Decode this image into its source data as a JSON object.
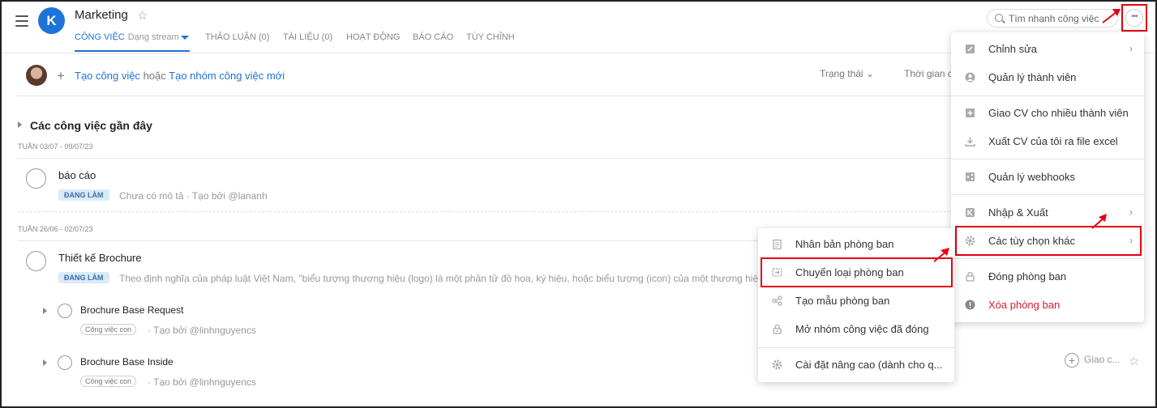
{
  "header": {
    "title": "Marketing",
    "logo_letter": "K",
    "search_placeholder": "Tìm nhanh công việc",
    "more_label": "•••"
  },
  "tabs": [
    {
      "label": "CÔNG VIỆC",
      "sub": "Dạng stream"
    },
    {
      "label": "THẢO LUẬN (0)"
    },
    {
      "label": "TÀI LIỆU (0)"
    },
    {
      "label": "HOẠT ĐỘNG"
    },
    {
      "label": "BÁO CÁO"
    },
    {
      "label": "TÙY CHỈNH"
    }
  ],
  "create": {
    "create_task": "Tạo công việc",
    "or": "hoặc",
    "create_group": "Tạo nhóm công việc mới"
  },
  "filters": {
    "status": "Trạng thái",
    "time": "Thời gian c"
  },
  "section": {
    "title": "Các công việc gần đây"
  },
  "weeks": [
    {
      "label": "TUẦN 03/07 - 09/07/23",
      "tasks": [
        {
          "title": "báo cáo",
          "badge": "ĐANG LÀM",
          "meta": "Chưa có mô tả · Tạo bởi @lananh"
        }
      ]
    },
    {
      "label": "TUẦN 26/06 - 02/07/23",
      "tasks": [
        {
          "title": "Thiết kế Brochure",
          "badge": "ĐANG LÀM",
          "meta": "Theo định nghĩa của pháp luật Việt Nam, \"biểu tượng thương hiệu (logo) là một phần tử đồ họa, ký hiệu, hoặc biểu tượng (icon) của một thương hiệu"
        }
      ]
    }
  ],
  "subtasks": [
    {
      "title": "Brochure Base Request",
      "chip": "Công việc con",
      "meta": "· Tạo bởi @linhnguyencs"
    },
    {
      "title": "Brochure Base Inside",
      "chip": "Công việc con",
      "meta": "· Tạo bởi @linhnguyencs"
    }
  ],
  "assign_label": "Giao c...",
  "main_menu": [
    {
      "label": "Chỉnh sửa",
      "icon": "edit-icon"
    },
    {
      "label": "Quản lý thành viên",
      "icon": "user-icon"
    },
    {
      "label": "Giao CV cho nhiều thành viên",
      "icon": "plus-square-icon"
    },
    {
      "label": "Xuất CV của tôi ra file excel",
      "icon": "download-icon"
    },
    {
      "label": "Quản lý webhooks",
      "icon": "share-icon"
    },
    {
      "label": "Nhập & Xuất",
      "icon": "logo-icon"
    },
    {
      "label": "Các tùy chọn khác",
      "icon": "gear-icon"
    },
    {
      "label": "Đóng phòng ban",
      "icon": "lock-icon"
    },
    {
      "label": "Xóa phòng ban",
      "icon": "alert-icon",
      "color": "#d32030"
    }
  ],
  "sub_menu": [
    {
      "label": "Nhân bản phòng ban",
      "icon": "clipboard-icon"
    },
    {
      "label": "Chuyển loại phòng ban",
      "icon": "convert-icon"
    },
    {
      "label": "Tạo mẫu phòng ban",
      "icon": "share-icon"
    },
    {
      "label": "Mở nhóm công việc đã đóng",
      "icon": "unlock-icon"
    },
    {
      "label": "Cài đặt nâng cao (dành cho q...",
      "icon": "gear-icon"
    }
  ],
  "colors": {
    "accent": "#1e73d8",
    "highlight": "#e60012",
    "danger": "#d32030"
  }
}
